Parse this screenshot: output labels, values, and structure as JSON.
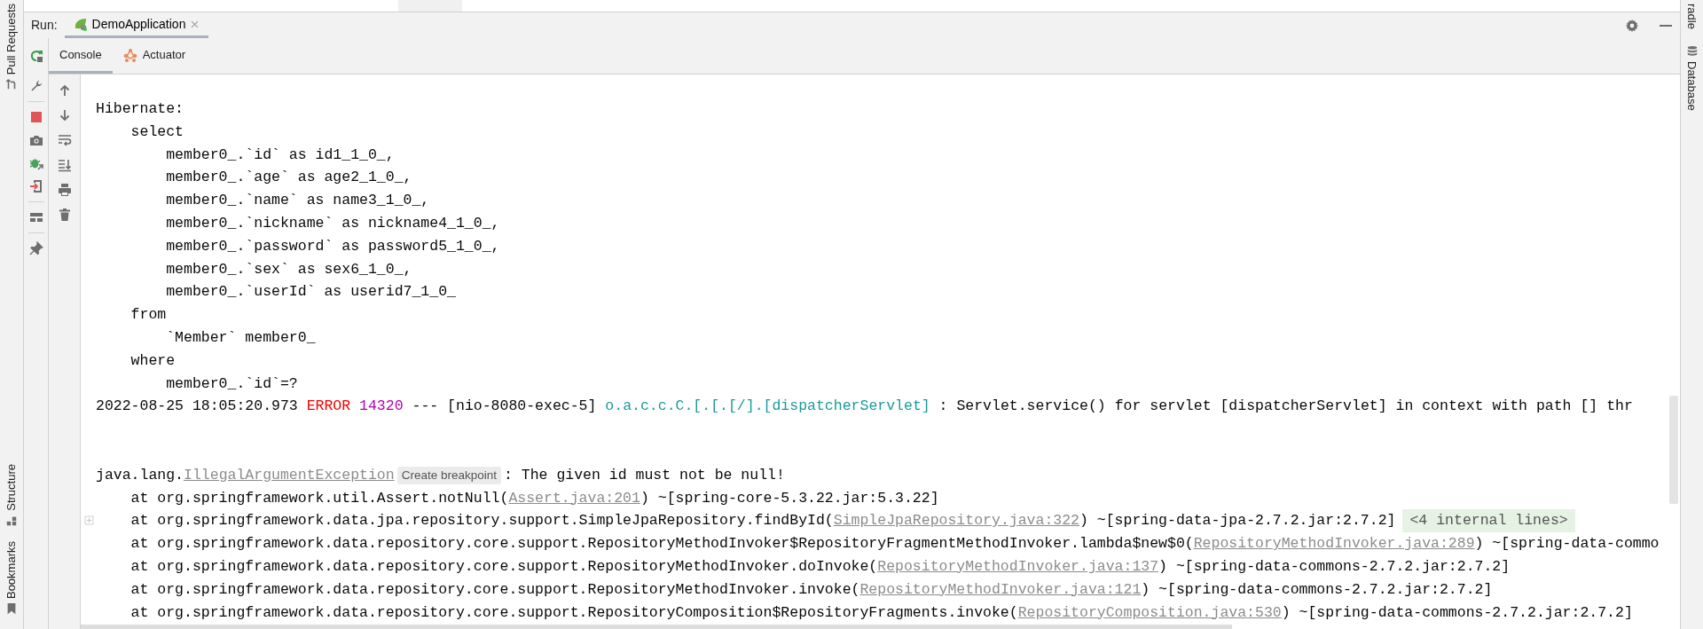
{
  "left_stripe": {
    "top": [
      {
        "label": "Pull Requests"
      }
    ],
    "bottom": [
      {
        "label": "Structure"
      },
      {
        "label": "Bookmarks"
      }
    ]
  },
  "right_stripe": [
    {
      "label": "radle",
      "kind": "text"
    },
    {
      "label": "Database",
      "kind": "icon_text"
    }
  ],
  "run_bar": {
    "label": "Run:",
    "tabs": [
      {
        "label": "DemoApplication",
        "selected": true,
        "closable": true
      }
    ]
  },
  "console_tabs": [
    {
      "label": "Console",
      "selected": true,
      "kind": "text"
    },
    {
      "label": "Actuator",
      "selected": false,
      "kind": "icon_text"
    }
  ],
  "console": {
    "lines": [
      {
        "kind": "log",
        "fold_marker": false,
        "segments": [
          {
            "kind": "text",
            "text": "Hibernate: "
          }
        ]
      },
      {
        "kind": "log",
        "fold_marker": false,
        "segments": [
          {
            "kind": "text",
            "text": "    select"
          }
        ]
      },
      {
        "kind": "log",
        "fold_marker": false,
        "segments": [
          {
            "kind": "text",
            "text": "        member0_.`id` as id1_1_0_,"
          }
        ]
      },
      {
        "kind": "log",
        "fold_marker": false,
        "segments": [
          {
            "kind": "text",
            "text": "        member0_.`age` as age2_1_0_,"
          }
        ]
      },
      {
        "kind": "log",
        "fold_marker": false,
        "segments": [
          {
            "kind": "text",
            "text": "        member0_.`name` as name3_1_0_,"
          }
        ]
      },
      {
        "kind": "log",
        "fold_marker": false,
        "segments": [
          {
            "kind": "text",
            "text": "        member0_.`nickname` as nickname4_1_0_,"
          }
        ]
      },
      {
        "kind": "log",
        "fold_marker": false,
        "segments": [
          {
            "kind": "text",
            "text": "        member0_.`password` as password5_1_0_,"
          }
        ]
      },
      {
        "kind": "log",
        "fold_marker": false,
        "segments": [
          {
            "kind": "text",
            "text": "        member0_.`sex` as sex6_1_0_,"
          }
        ]
      },
      {
        "kind": "log",
        "fold_marker": false,
        "segments": [
          {
            "kind": "text",
            "text": "        member0_.`userId` as userid7_1_0_"
          }
        ]
      },
      {
        "kind": "log",
        "fold_marker": false,
        "segments": [
          {
            "kind": "text",
            "text": "    from"
          }
        ]
      },
      {
        "kind": "log",
        "fold_marker": false,
        "segments": [
          {
            "kind": "text",
            "text": "        `Member` member0_"
          }
        ]
      },
      {
        "kind": "log",
        "fold_marker": false,
        "segments": [
          {
            "kind": "text",
            "text": "    where"
          }
        ]
      },
      {
        "kind": "log",
        "fold_marker": false,
        "segments": [
          {
            "kind": "text",
            "text": "        member0_.`id`=?"
          }
        ]
      },
      {
        "kind": "log",
        "fold_marker": false,
        "segments": [
          {
            "kind": "text",
            "text": "2022-08-25 18:05:20.973 "
          },
          {
            "kind": "level",
            "text": "ERROR "
          },
          {
            "kind": "pid",
            "text": "14320"
          },
          {
            "kind": "text",
            "text": " --- [nio-8080-exec-5] "
          },
          {
            "kind": "logger",
            "text": "o.a.c.c.C.[.[.[/].[dispatcherServlet]"
          },
          {
            "kind": "text",
            "text": " : Servlet.service() for servlet [dispatcherServlet] in context with path [] thr"
          }
        ]
      },
      {
        "kind": "blank",
        "fold_marker": false
      },
      {
        "kind": "blank",
        "fold_marker": false
      },
      {
        "kind": "log",
        "fold_marker": false,
        "segments": [
          {
            "kind": "text",
            "text": "java.lang."
          },
          {
            "kind": "link",
            "text": "IllegalArgumentException"
          },
          {
            "kind": "hint",
            "text": "Create breakpoint"
          },
          {
            "kind": "text",
            "text": ": The given id must not be null!"
          }
        ]
      },
      {
        "kind": "log",
        "fold_marker": false,
        "segments": [
          {
            "kind": "text",
            "text": "    at org.springframework.util.Assert.notNull("
          },
          {
            "kind": "link",
            "text": "Assert.java:201"
          },
          {
            "kind": "text",
            "text": ") ~[spring-core-5.3.22.jar:5.3.22]"
          }
        ]
      },
      {
        "kind": "log",
        "fold_marker": true,
        "segments": [
          {
            "kind": "text",
            "text": "    at org.springframework.data.jpa.repository.support.SimpleJpaRepository.findById("
          },
          {
            "kind": "link",
            "text": "SimpleJpaRepository.java:322"
          },
          {
            "kind": "text",
            "text": ") ~[spring-data-jpa-2.7.2.jar:2.7.2]"
          },
          {
            "kind": "folded",
            "text": "<4 internal lines>"
          }
        ]
      },
      {
        "kind": "log",
        "fold_marker": false,
        "segments": [
          {
            "kind": "text",
            "text": "    at org.springframework.data.repository.core.support.RepositoryMethodInvoker$RepositoryFragmentMethodInvoker.lambda$new$0("
          },
          {
            "kind": "link",
            "text": "RepositoryMethodInvoker.java:289"
          },
          {
            "kind": "text",
            "text": ") ~[spring-data-commo"
          }
        ]
      },
      {
        "kind": "log",
        "fold_marker": false,
        "segments": [
          {
            "kind": "text",
            "text": "    at org.springframework.data.repository.core.support.RepositoryMethodInvoker.doInvoke("
          },
          {
            "kind": "link",
            "text": "RepositoryMethodInvoker.java:137"
          },
          {
            "kind": "text",
            "text": ") ~[spring-data-commons-2.7.2.jar:2.7.2]"
          }
        ]
      },
      {
        "kind": "log",
        "fold_marker": false,
        "segments": [
          {
            "kind": "text",
            "text": "    at org.springframework.data.repository.core.support.RepositoryMethodInvoker.invoke("
          },
          {
            "kind": "link",
            "text": "RepositoryMethodInvoker.java:121"
          },
          {
            "kind": "text",
            "text": ") ~[spring-data-commons-2.7.2.jar:2.7.2]"
          }
        ]
      },
      {
        "kind": "log",
        "fold_marker": false,
        "segments": [
          {
            "kind": "text",
            "text": "    at org.springframework.data.repository.core.support.RepositoryComposition$RepositoryFragments.invoke("
          },
          {
            "kind": "link",
            "text": "RepositoryComposition.java:530"
          },
          {
            "kind": "text",
            "text": ") ~[spring-data-commons-2.7.2.jar:2.7.2]"
          }
        ]
      }
    ]
  }
}
